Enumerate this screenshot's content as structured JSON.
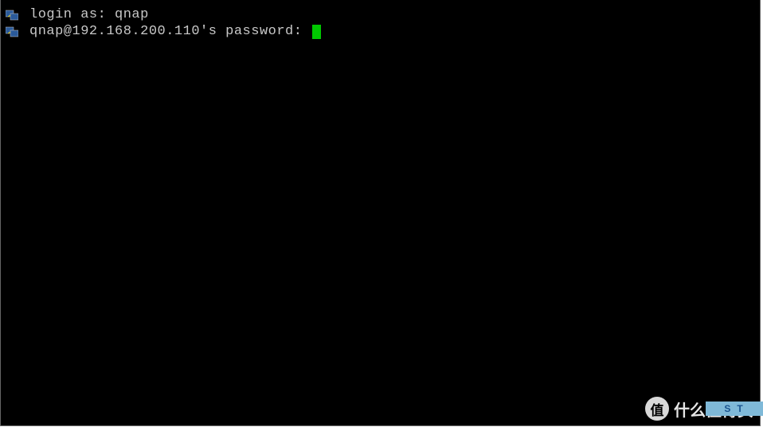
{
  "terminal": {
    "lines": [
      {
        "prompt": "login as: ",
        "input": "qnap"
      },
      {
        "prompt": "qnap@192.168.200.110's password: ",
        "input": ""
      }
    ]
  },
  "watermark": {
    "badge": "值",
    "text": "什么值得买",
    "secondary": "ST"
  }
}
